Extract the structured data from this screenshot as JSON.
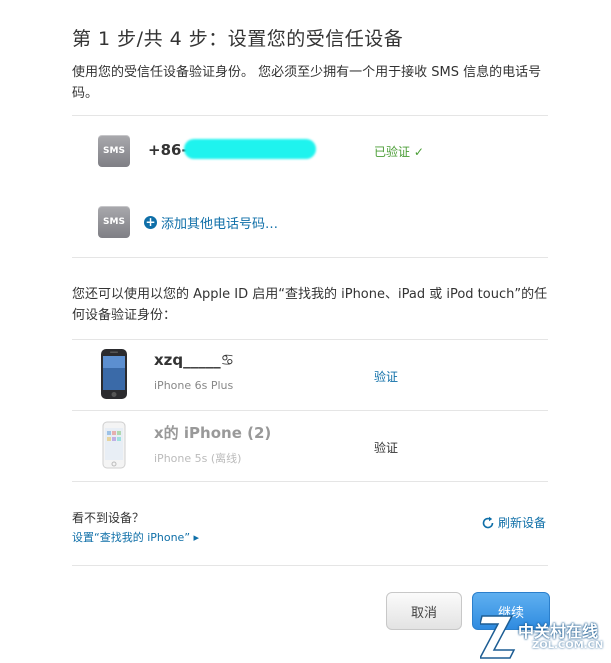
{
  "title": "第 1 步/共 4 步：设置您的受信任设备",
  "intro": "使用您的受信任设备验证身份。 您必须至少拥有一个用于接收 SMS 信息的电话号码。",
  "sms": {
    "icon_label": "SMS",
    "phone_prefix": "+86-",
    "verified_label": "已验证",
    "verified_check": "✓",
    "add_link": "添加其他电话号码…"
  },
  "devices_intro": "您还可以使用以您的 Apple ID 启用“查找我的 iPhone、iPad 或 iPod touch”的任何设备验证身份：",
  "devices": [
    {
      "name": "xzq_____♋",
      "model": "iPhone 6s Plus",
      "action": "验证",
      "active": true
    },
    {
      "name": "x的 iPhone (2)",
      "model": "iPhone 5s (离线)",
      "action": "验证",
      "active": false
    }
  ],
  "footer": {
    "cant_see": "看不到设备？",
    "setup_link": "设置“查找我的 iPhone” ▸",
    "refresh": "刷新设备"
  },
  "buttons": {
    "cancel": "取消",
    "continue": "继续"
  },
  "watermark": {
    "main": "中关村在线",
    "sub": "ZOL.COM.CN"
  },
  "colors": {
    "link": "#0f6fa8",
    "verified": "#4a9d35",
    "mask": "#1ff3ee",
    "primary": "#2f8be0"
  }
}
